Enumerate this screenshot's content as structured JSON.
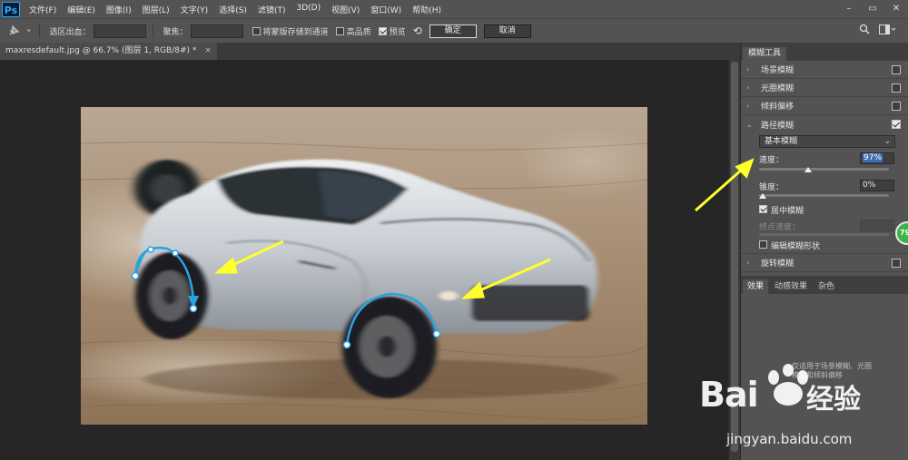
{
  "app": {
    "logo": "Ps",
    "menus": [
      "文件(F)",
      "编辑(E)",
      "图像(I)",
      "图层(L)",
      "文字(Y)",
      "选择(S)",
      "滤镜(T)",
      "3D(D)",
      "视图(V)",
      "窗口(W)",
      "帮助(H)"
    ],
    "window_controls": [
      "–",
      "▭",
      "✕"
    ]
  },
  "options_bar": {
    "tool_icon": "pin-tool-icon",
    "selection_output_label": "选区出血：",
    "focus_label": "聚焦：",
    "save_mask_label": "将蒙版存储到通道",
    "save_mask_checked": false,
    "high_quality_label": "高品质",
    "high_quality_checked": false,
    "preview_label": "预览",
    "preview_checked": true,
    "ok_label": "确定",
    "cancel_label": "取消"
  },
  "document": {
    "tab_title": "maxresdefault.jpg @ 66.7% (图层 1, RGB/8#) *",
    "close_glyph": "×"
  },
  "blur_panel": {
    "title": "模糊工具",
    "items": [
      {
        "label": "场景模糊",
        "checked": false,
        "expanded": false
      },
      {
        "label": "光圈模糊",
        "checked": false,
        "expanded": false
      },
      {
        "label": "倾斜偏移",
        "checked": false,
        "expanded": false
      },
      {
        "label": "路径模糊",
        "checked": true,
        "expanded": true
      },
      {
        "label": "旋转模糊",
        "checked": false,
        "expanded": false
      }
    ],
    "path_blur": {
      "type_value": "基本模糊",
      "speed_label": "速度：",
      "speed_value": "97%",
      "speed_fraction": 0.97,
      "taper_label": "锥度：",
      "taper_value": "0%",
      "taper_fraction": 0.0,
      "centered_label": "居中模糊",
      "centered_checked": true,
      "end_speed_label": "终点速度：",
      "edit_shapes_label": "编辑模糊形状",
      "edit_shapes_checked": false
    }
  },
  "effects_panel": {
    "tabs": [
      "效果",
      "动感效果",
      "杂色"
    ],
    "note": "仅适用于场景模糊、光圈模糊和倾斜偏移"
  },
  "badge": {
    "text": "79"
  },
  "watermark": {
    "brand": "Bai",
    "brand_suffix": "经验",
    "url": "jingyan.baidu.com"
  },
  "colors": {
    "arrow": "#ffff2a",
    "path": "#29a3e0",
    "accent_select": "#3e6fb6",
    "badge": "#3bb44a"
  }
}
